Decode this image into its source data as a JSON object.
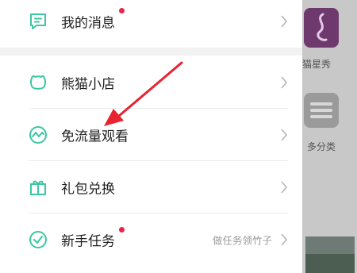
{
  "menu": {
    "items": [
      {
        "label": "我的消息",
        "icon": "message-icon",
        "has_badge": true,
        "sub": ""
      },
      {
        "label": "熊猫小店",
        "icon": "panda-shop-icon",
        "has_badge": false,
        "sub": ""
      },
      {
        "label": "免流量观看",
        "icon": "wave-icon",
        "has_badge": false,
        "sub": ""
      },
      {
        "label": "礼包兑换",
        "icon": "gift-icon",
        "has_badge": false,
        "sub": ""
      },
      {
        "label": "新手任务",
        "icon": "check-circle-icon",
        "has_badge": true,
        "sub": "做任务领竹子"
      }
    ]
  },
  "background": {
    "tile1_label": "猫星秀",
    "tile2_label": "多分类"
  },
  "colors": {
    "accent": "#3cc6a3",
    "badge": "#e8254a",
    "arrow": "#e8222e"
  }
}
